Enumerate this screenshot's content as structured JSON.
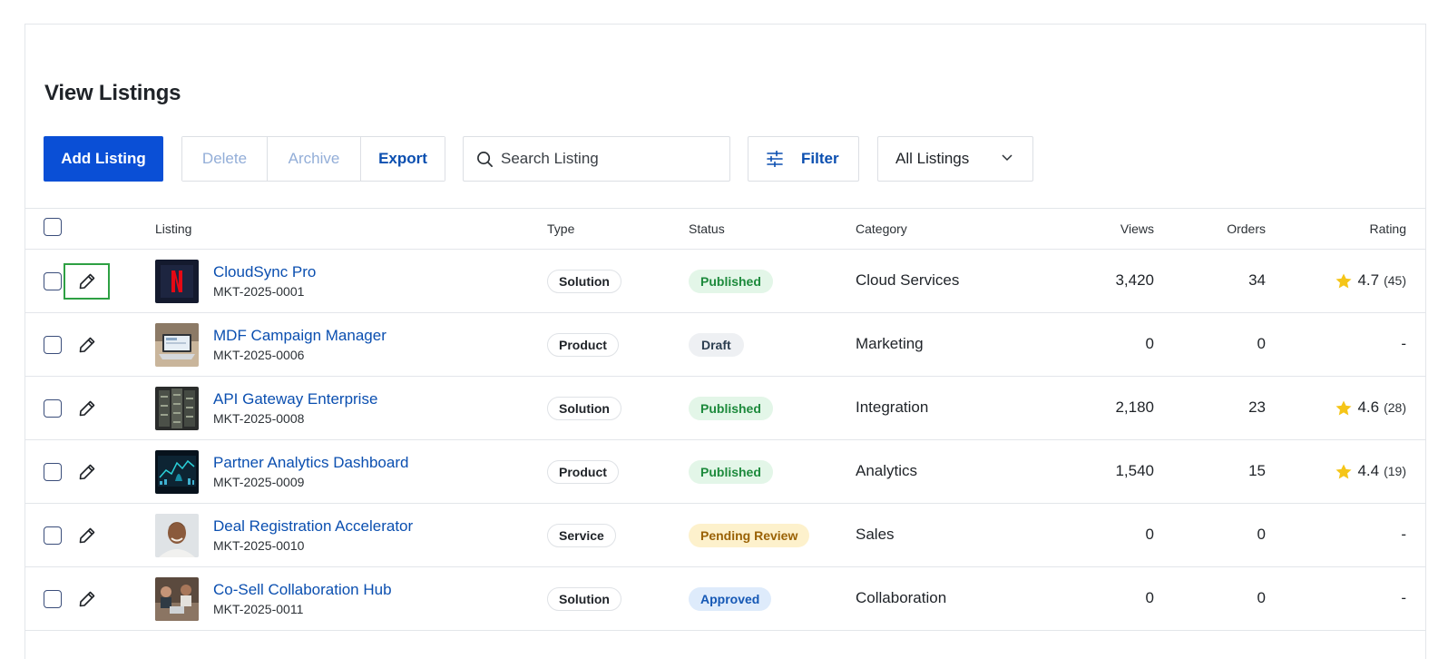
{
  "page": {
    "title": "View Listings"
  },
  "toolbar": {
    "add_label": "Add Listing",
    "delete_label": "Delete",
    "archive_label": "Archive",
    "export_label": "Export",
    "search_placeholder": "Search Listing",
    "filter_label": "Filter",
    "scope_selected": "All Listings"
  },
  "table": {
    "columns": [
      "Listing",
      "Type",
      "Status",
      "Category",
      "Views",
      "Orders",
      "Rating"
    ],
    "rows": [
      {
        "name": "CloudSync Pro",
        "id": "MKT-2025-0001",
        "type": "Solution",
        "status": "Published",
        "category": "Cloud Services",
        "views": "3,420",
        "orders": "34",
        "rating": "4.7",
        "rating_count": "(45)",
        "thumb": "netflix-logo"
      },
      {
        "name": "MDF Campaign Manager",
        "id": "MKT-2025-0006",
        "type": "Product",
        "status": "Draft",
        "category": "Marketing",
        "views": "0",
        "orders": "0",
        "rating": "-",
        "rating_count": "",
        "thumb": "laptop-photo"
      },
      {
        "name": "API Gateway Enterprise",
        "id": "MKT-2025-0008",
        "type": "Solution",
        "status": "Published",
        "category": "Integration",
        "views": "2,180",
        "orders": "23",
        "rating": "4.6",
        "rating_count": "(28)",
        "thumb": "server-rack-photo"
      },
      {
        "name": "Partner Analytics Dashboard",
        "id": "MKT-2025-0009",
        "type": "Product",
        "status": "Published",
        "category": "Analytics",
        "views": "1,540",
        "orders": "15",
        "rating": "4.4",
        "rating_count": "(19)",
        "thumb": "dashboard-screen-photo"
      },
      {
        "name": "Deal Registration Accelerator",
        "id": "MKT-2025-0010",
        "type": "Service",
        "status": "Pending Review",
        "category": "Sales",
        "views": "0",
        "orders": "0",
        "rating": "-",
        "rating_count": "",
        "thumb": "person-portrait-photo"
      },
      {
        "name": "Co-Sell Collaboration Hub",
        "id": "MKT-2025-0011",
        "type": "Solution",
        "status": "Approved",
        "category": "Collaboration",
        "views": "0",
        "orders": "0",
        "rating": "-",
        "rating_count": "",
        "thumb": "team-meeting-photo"
      }
    ]
  },
  "colors": {
    "primary": "#0a4fd6",
    "link": "#0b4fb0",
    "focus_outline": "#2ea043",
    "star": "#f5c518"
  },
  "icons": {
    "search": "search-icon",
    "filter": "sliders-icon",
    "dropdown": "chevron-down-icon",
    "edit": "pencil-icon",
    "rating": "star-icon"
  }
}
